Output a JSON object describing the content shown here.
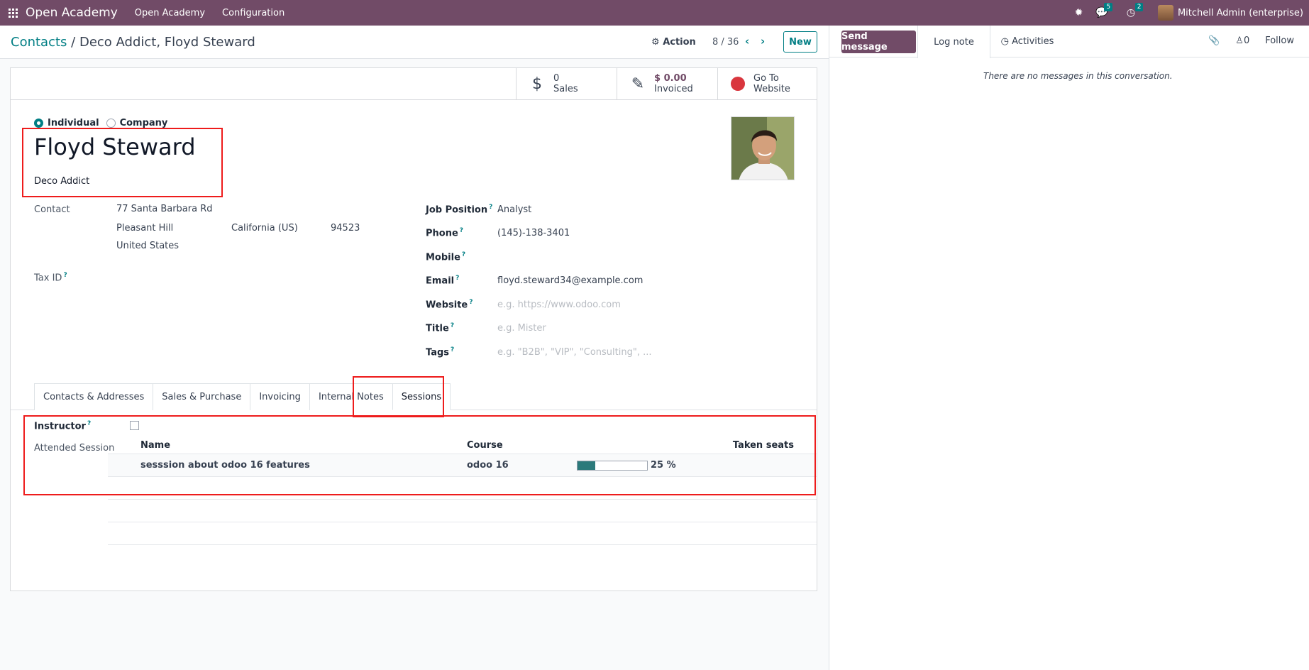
{
  "navbar": {
    "brand": "Open Academy",
    "menus": [
      "Open Academy",
      "Configuration"
    ],
    "messages_badge": "5",
    "activities_badge": "2",
    "user": "Mitchell Admin (enterprise)",
    "bar_color": "#714b67"
  },
  "control": {
    "breadcrumb_root": "Contacts",
    "breadcrumb_sep": "/",
    "breadcrumb_current": "Deco Addict, Floyd Steward",
    "action_label": "Action",
    "pager": "8 / 36",
    "new_label": "New"
  },
  "stats": {
    "sales_value": "0",
    "sales_label": "Sales",
    "invoiced_value": "$ 0.00",
    "invoiced_label": "Invoiced",
    "website_line1": "Go To",
    "website_line2": "Website"
  },
  "partner": {
    "type_individual": "Individual",
    "type_company": "Company",
    "name": "Floyd Steward",
    "company": "Deco Addict",
    "contact_label": "Contact",
    "street": "77 Santa Barbara Rd",
    "city": "Pleasant Hill",
    "state": "California (US)",
    "zip": "94523",
    "country": "United States",
    "tax_id_label": "Tax ID",
    "job_position_label": "Job Position",
    "job_position": "Analyst",
    "phone_label": "Phone",
    "phone": "(145)-138-3401",
    "mobile_label": "Mobile",
    "email_label": "Email",
    "email": "floyd.steward34@example.com",
    "website_label": "Website",
    "website_placeholder": "e.g. https://www.odoo.com",
    "title_label": "Title",
    "title_placeholder": "e.g. Mister",
    "tags_label": "Tags",
    "tags_placeholder": "e.g. \"B2B\", \"VIP\", \"Consulting\", ..."
  },
  "tabs": [
    "Contacts & Addresses",
    "Sales & Purchase",
    "Invoicing",
    "Internal Notes",
    "Sessions"
  ],
  "sessions": {
    "instructor_label": "Instructor",
    "attended_label": "Attended Session",
    "columns": [
      "Name",
      "Course",
      "Taken seats"
    ],
    "rows": [
      {
        "name": "sesssion about odoo 16 features",
        "course": "odoo 16",
        "taken_seats": 25,
        "taken_seats_label": "25 %"
      }
    ]
  },
  "chatter": {
    "send_message": "Send message",
    "log_note": "Log note",
    "activities": "Activities",
    "followers_count": "0",
    "follow": "Follow",
    "empty": "There are no messages in this conversation."
  }
}
